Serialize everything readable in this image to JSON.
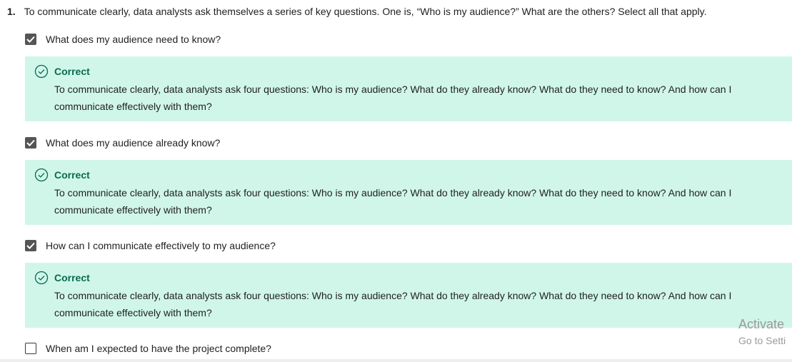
{
  "question": {
    "number": "1.",
    "text": "To communicate clearly, data analysts ask themselves a series of key questions. One is, “Who is my audience?” What are the others? Select all that apply."
  },
  "options": [
    {
      "label": "What does my audience need to know?",
      "checked": true,
      "feedback": {
        "title": "Correct",
        "body": "To communicate clearly, data analysts ask four questions: Who is my audience? What do they already know? What do they need to know? And how can I communicate effectively with them?"
      }
    },
    {
      "label": "What does my audience already know?",
      "checked": true,
      "feedback": {
        "title": "Correct",
        "body": "To communicate clearly, data analysts ask four questions: Who is my audience? What do they already know? What do they need to know? And how can I communicate effectively with them?"
      }
    },
    {
      "label": "How can I communicate effectively to my audience?",
      "checked": true,
      "feedback": {
        "title": "Correct",
        "body": "To communicate clearly, data analysts ask four questions: Who is my audience? What do they already know? What do they need to know? And how can I communicate effectively with them?"
      }
    },
    {
      "label": "When am I expected to have the project complete?",
      "checked": false
    }
  ],
  "watermark": {
    "line1": "Activate",
    "line2": "Go to Setti"
  },
  "icons": {
    "checkmark": "check-icon",
    "feedback": "check-circle-icon"
  },
  "colors": {
    "feedback_bg": "#d0f6ea",
    "correct_text": "#0b6b4f",
    "checkbox_checked": "#555555"
  }
}
